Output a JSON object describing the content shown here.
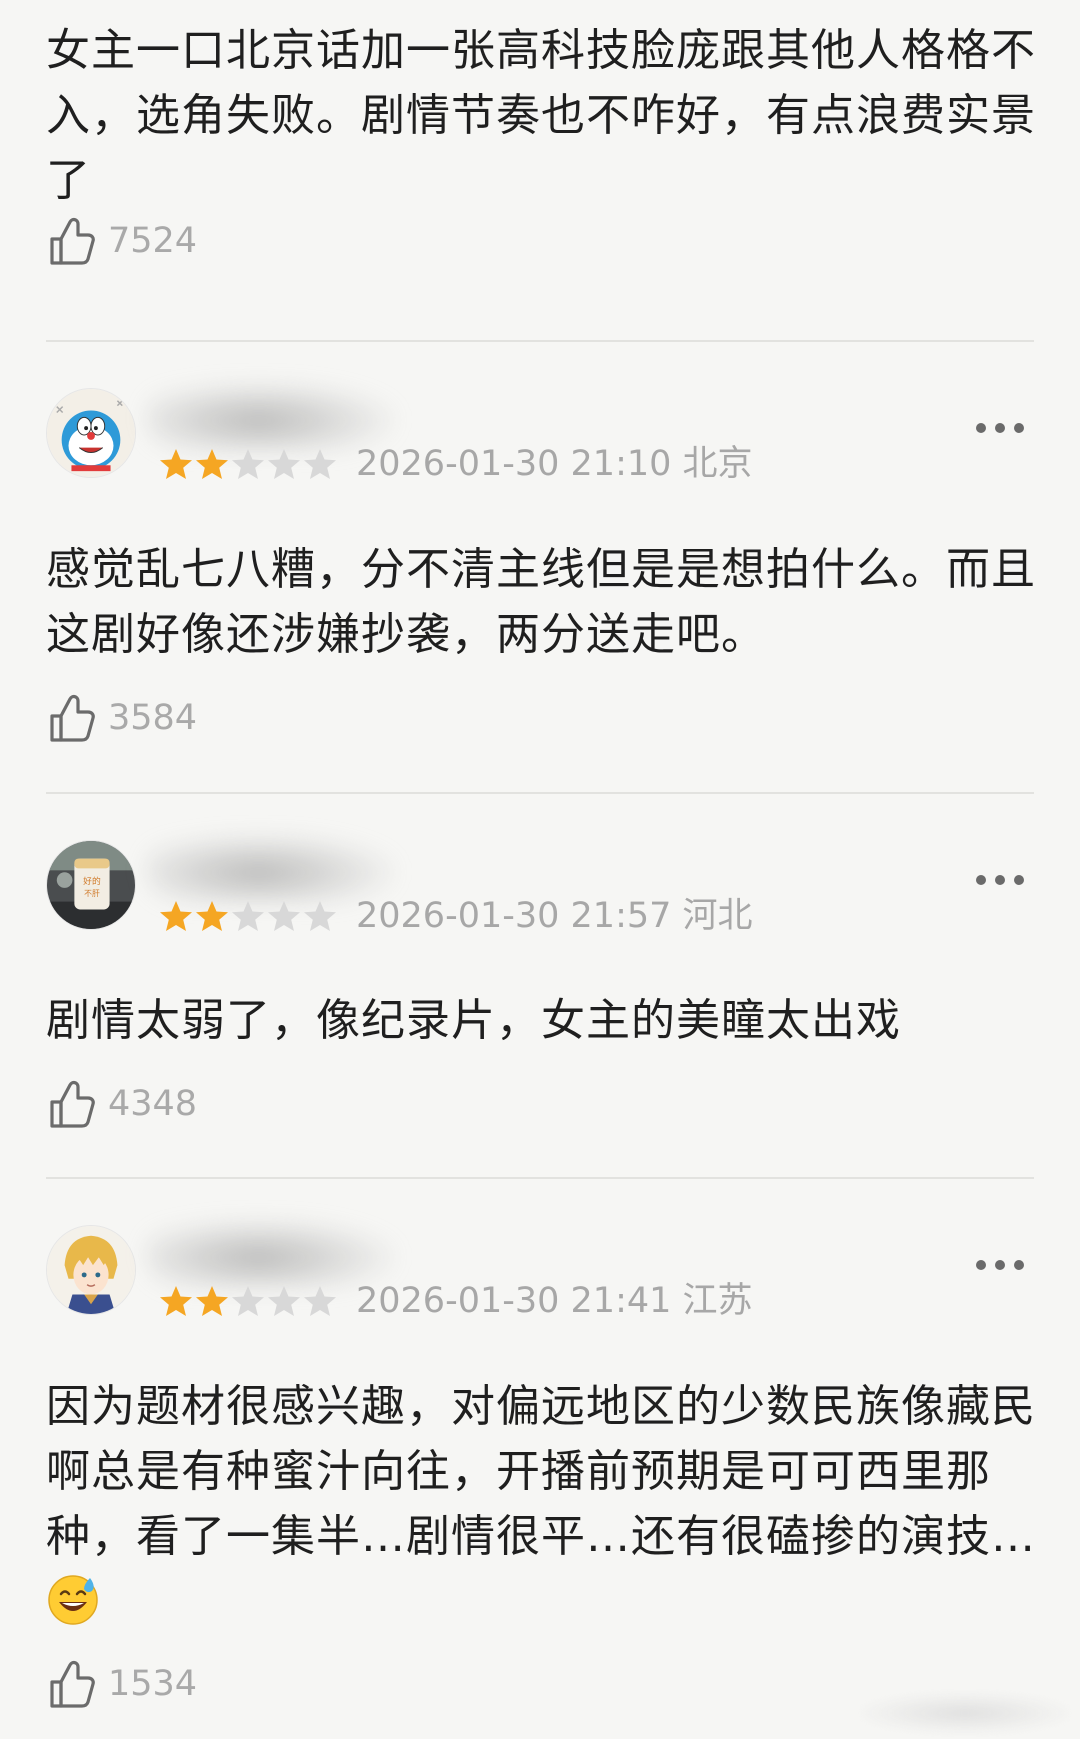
{
  "comments": [
    {
      "text": "女主一口北京话加一张高科技脸庞跟其他人格格不入，选角失败。剧情节奏也不咋好，有点浪费实景了",
      "likes": "7524"
    },
    {
      "username": "",
      "rating": 2,
      "meta": "2026-01-30 21:10 北京",
      "text": "感觉乱七八糟，分不清主线但是是想拍什么。而且这剧好像还涉嫌抄袭，两分送走吧。",
      "likes": "3584",
      "avatar": "doraemon-avatar"
    },
    {
      "username": "",
      "rating": 2,
      "meta": "2026-01-30 21:57 河北",
      "text": "剧情太弱了，像纪录片，女主的美瞳太出戏",
      "likes": "4348",
      "avatar": "photo-avatar"
    },
    {
      "username": "",
      "rating": 2,
      "meta": "2026-01-30 21:41 江苏",
      "text": "因为题材很感兴趣，对偏远地区的少数民族像藏民啊总是有种蜜汁向往，开播前预期是可可西里那种，看了一集半…剧情很平…还有很磕掺的演技…",
      "likes": "1534",
      "avatar": "anime-avatar",
      "emoji": "sweat-smile-emoji"
    }
  ],
  "colors": {
    "star_filled": "#f5a623",
    "star_empty": "#d8d8d8",
    "meta_text": "#a7a7a7",
    "background": "#f6f6f4"
  },
  "icons": {
    "like": "thumbs-up-icon",
    "more": "more-dots-icon"
  }
}
